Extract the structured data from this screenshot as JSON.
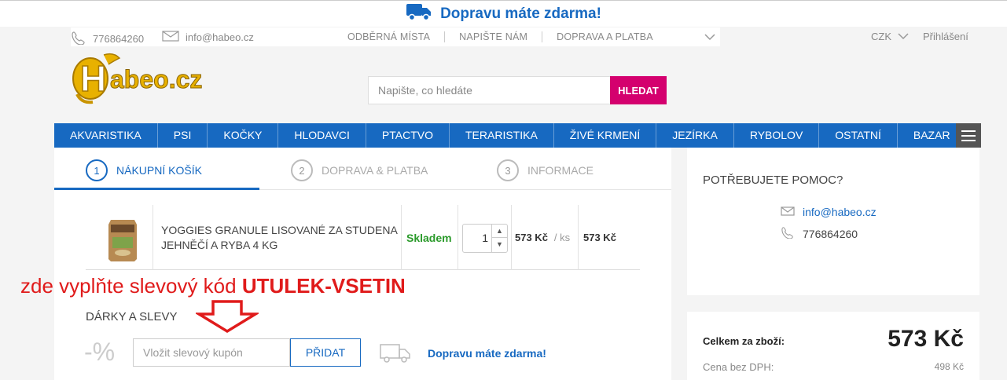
{
  "banner": {
    "text": "Dopravu máte zdarma!"
  },
  "util": {
    "phone": "776864260",
    "email": "info@habeo.cz",
    "links": [
      "ODBĚRNÁ MÍSTA",
      "NAPIŠTE NÁM",
      "DOPRAVA A PLATBA"
    ],
    "currency": "CZK",
    "login": "Přihlášení"
  },
  "logo": {
    "text": "Habeo.cz"
  },
  "search": {
    "placeholder": "Napište, co hledáte",
    "button": "HLEDAT"
  },
  "nav": [
    "AKVARISTIKA",
    "PSI",
    "KOČKY",
    "HLODAVCI",
    "PTACTVO",
    "TERARISTIKA",
    "ŽIVÉ KRMENÍ",
    "JEZÍRKA",
    "RYBOLOV",
    "OSTATNÍ",
    "BAZAR"
  ],
  "steps": [
    {
      "num": "1",
      "label": "NÁKUPNÍ KOŠÍK"
    },
    {
      "num": "2",
      "label": "DOPRAVA & PLATBA"
    },
    {
      "num": "3",
      "label": "INFORMACE"
    }
  ],
  "cart": {
    "name_line1": "YOGGIES GRANULE LISOVANÉ ZA STUDENA",
    "name_line2": "JEHNĚČÍ A RYBA 4 KG",
    "stock": "Skladem",
    "qty": "1",
    "unit_price": "573 Kč",
    "per_unit": "/ ks",
    "total": "573 Kč"
  },
  "annotation": {
    "text": "zde vyplňte slevový kód ",
    "code": "UTULEK-VSETIN",
    "color": "#e01b1b"
  },
  "gifts": {
    "title": "DÁRKY A SLEVY",
    "percent": "-%",
    "coupon_placeholder": "Vložit slevový kupón",
    "add_button": "PŘIDAT",
    "free_shipping": "Dopravu máte zdarma!"
  },
  "help": {
    "title": "POTŘEBUJETE POMOC?",
    "email": "info@habeo.cz",
    "phone": "776864260"
  },
  "summary": {
    "total_label": "Celkem za zboží:",
    "total_value": "573 Kč",
    "net_label": "Cena bez DPH:",
    "net_value": "498 Kč"
  },
  "colors": {
    "brand_blue": "#1769c1",
    "search_button": "#d4006e",
    "in_stock": "#2a9a2a"
  }
}
